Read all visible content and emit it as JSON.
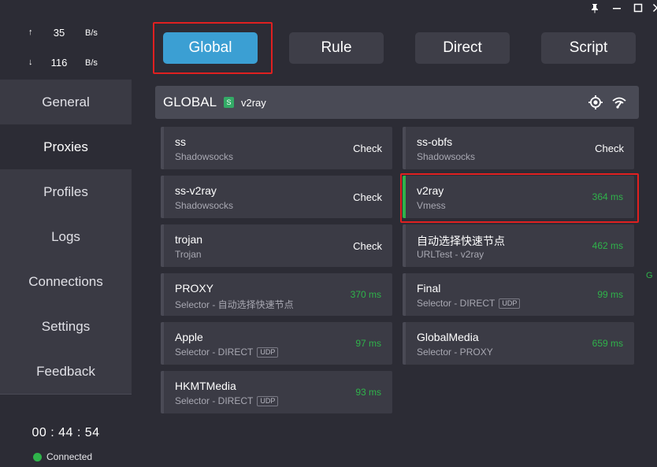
{
  "traffic": {
    "up_arrow": "↑",
    "up_value": "35",
    "up_unit": "B/s",
    "down_arrow": "↓",
    "down_value": "116",
    "down_unit": "B/s"
  },
  "nav": {
    "items": [
      {
        "label": "General"
      },
      {
        "label": "Proxies"
      },
      {
        "label": "Profiles"
      },
      {
        "label": "Logs"
      },
      {
        "label": "Connections"
      },
      {
        "label": "Settings"
      },
      {
        "label": "Feedback"
      }
    ],
    "active": "Proxies"
  },
  "status": {
    "timer": "00 : 44 : 54",
    "connection": "Connected",
    "connection_color": "#2fb34a"
  },
  "window_controls": {
    "pin": "📌",
    "minimize": "—",
    "maximize": "☐",
    "close": "✕"
  },
  "modes": [
    {
      "label": "Global"
    },
    {
      "label": "Rule"
    },
    {
      "label": "Direct"
    },
    {
      "label": "Script"
    }
  ],
  "active_mode": "Global",
  "group": {
    "title": "GLOBAL",
    "badge": "S",
    "now": "v2ray",
    "icons": [
      "locate-icon",
      "wifi-speed-icon"
    ]
  },
  "proxies": [
    {
      "name": "ss",
      "type": "Shadowsocks",
      "udp": "",
      "latency": "",
      "action": "Check"
    },
    {
      "name": "ss-obfs",
      "type": "Shadowsocks",
      "udp": "",
      "latency": "",
      "action": "Check"
    },
    {
      "name": "ss-v2ray",
      "type": "Shadowsocks",
      "udp": "",
      "latency": "",
      "action": "Check"
    },
    {
      "name": "v2ray",
      "type": "Vmess",
      "udp": "",
      "latency": "364 ms",
      "action": ""
    },
    {
      "name": "trojan",
      "type": "Trojan",
      "udp": "",
      "latency": "",
      "action": "Check"
    },
    {
      "name": "自动选择快速节点",
      "type": "URLTest - v2ray",
      "udp": "",
      "latency": "462 ms",
      "action": ""
    },
    {
      "name": "PROXY",
      "type": "Selector - 自动选择快速节点",
      "udp": "",
      "latency": "370 ms",
      "action": ""
    },
    {
      "name": "Final",
      "type": "Selector - DIRECT",
      "udp": "UDP",
      "latency": "99 ms",
      "action": ""
    },
    {
      "name": "Apple",
      "type": "Selector - DIRECT",
      "udp": "UDP",
      "latency": "97 ms",
      "action": ""
    },
    {
      "name": "GlobalMedia",
      "type": "Selector - PROXY",
      "udp": "",
      "latency": "659 ms",
      "action": ""
    },
    {
      "name": "HKMTMedia",
      "type": "Selector - DIRECT",
      "udp": "UDP",
      "latency": "93 ms",
      "action": ""
    }
  ],
  "selected_proxy": "v2ray",
  "edge_text": "G",
  "colors": {
    "accent": "#3b9fd3",
    "latency_good": "#2fb34a",
    "highlight": "#e02020"
  }
}
